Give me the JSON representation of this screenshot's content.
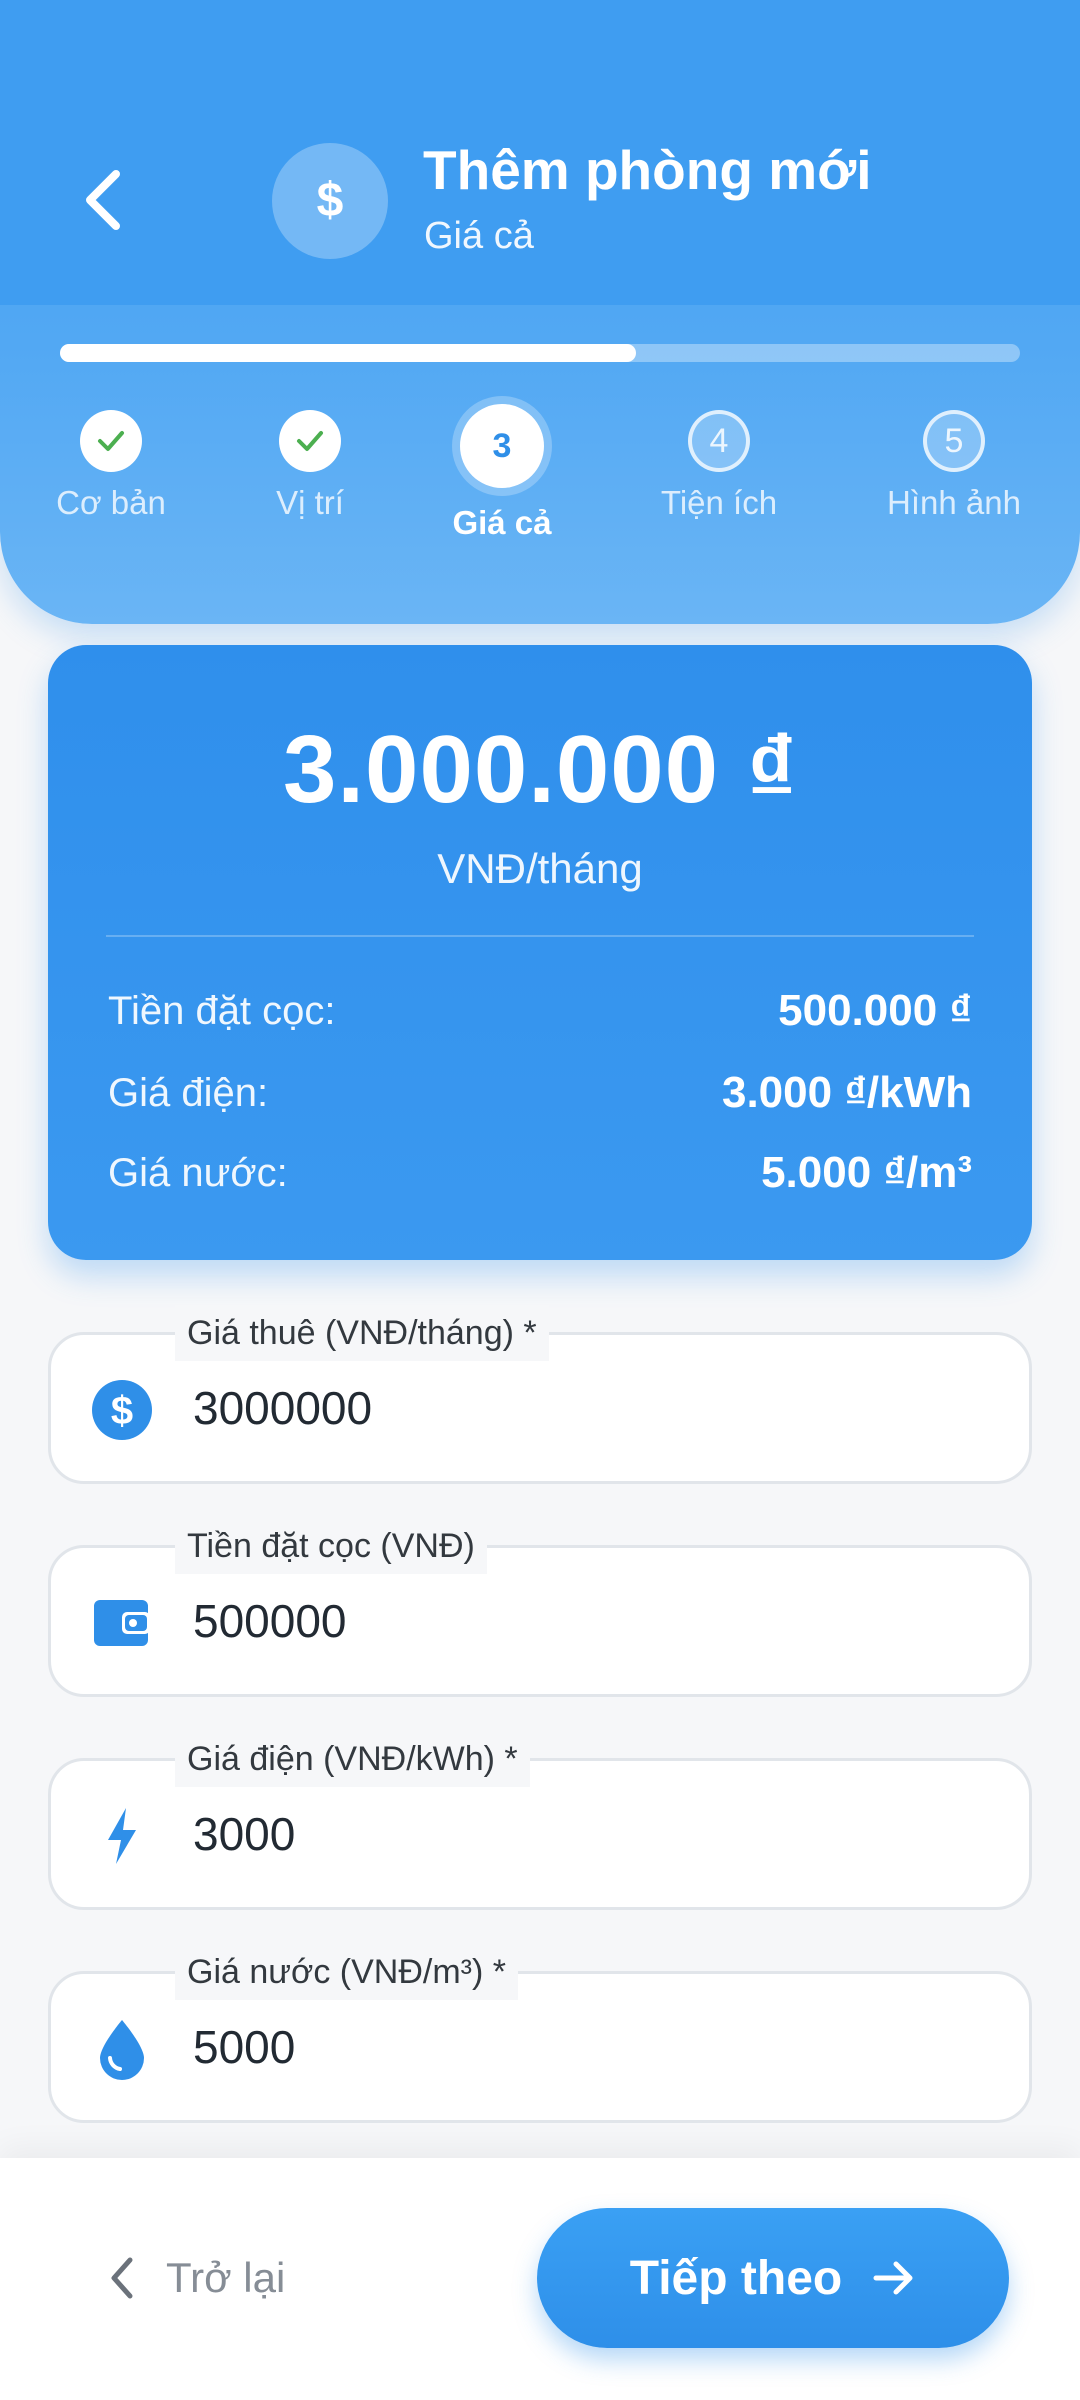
{
  "header": {
    "title": "Thêm phòng mới",
    "subtitle": "Giá cả",
    "icon": "dollar-icon",
    "progress_fraction": 0.6
  },
  "steps": [
    {
      "number": "1",
      "label": "Cơ bản",
      "state": "done"
    },
    {
      "number": "2",
      "label": "Vị trí",
      "state": "done"
    },
    {
      "number": "3",
      "label": "Giá cả",
      "state": "active"
    },
    {
      "number": "4",
      "label": "Tiện ích",
      "state": "future"
    },
    {
      "number": "5",
      "label": "Hình ảnh",
      "state": "future"
    }
  ],
  "summary": {
    "price": "3.000.000 ₫",
    "unit": "VNĐ/tháng",
    "rows": [
      {
        "label": "Tiền đặt cọc:",
        "value": "500.000 ₫"
      },
      {
        "label": "Giá điện:",
        "value": "3.000 ₫/kWh"
      },
      {
        "label": "Giá nước:",
        "value": "5.000 ₫/m³"
      }
    ]
  },
  "fields": [
    {
      "label": "Giá thuê (VNĐ/tháng) *",
      "value": "3000000",
      "icon": "dollar-circle-icon"
    },
    {
      "label": "Tiền đặt cọc (VNĐ)",
      "value": "500000",
      "icon": "wallet-icon"
    },
    {
      "label": "Giá điện (VNĐ/kWh) *",
      "value": "3000",
      "icon": "lightning-icon"
    },
    {
      "label": "Giá nước (VNĐ/m³) *",
      "value": "5000",
      "icon": "water-drop-icon"
    }
  ],
  "footer": {
    "back_label": "Trở lại",
    "next_label": "Tiếp theo"
  },
  "colors": {
    "primary": "#2f8fe8",
    "header": "#3f9df1",
    "check": "#4caf50"
  }
}
